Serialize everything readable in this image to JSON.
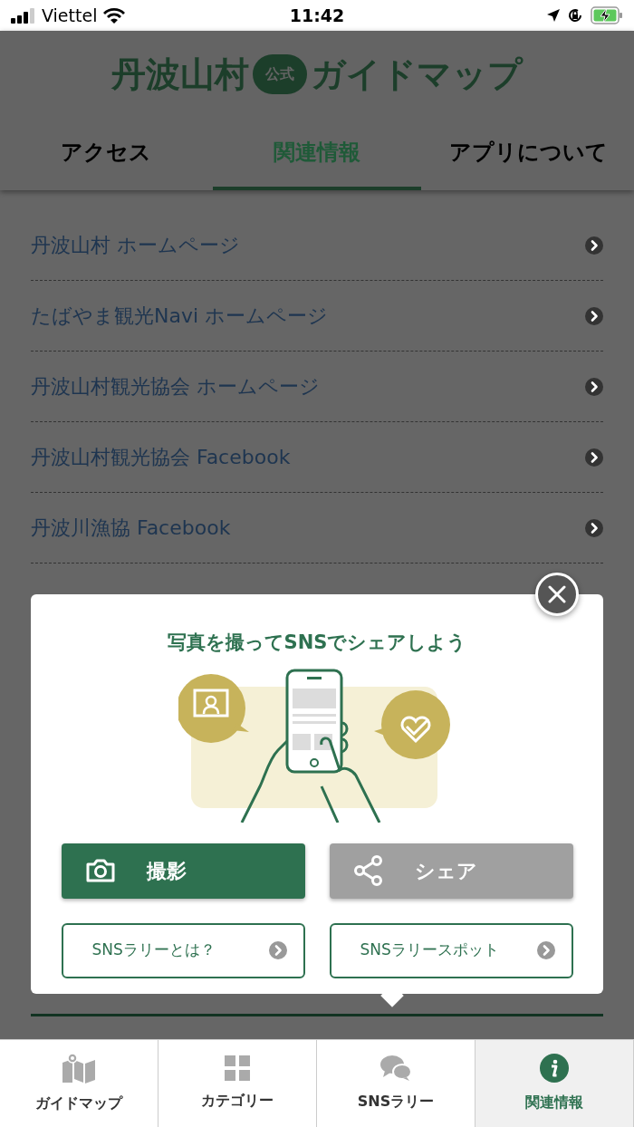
{
  "status_bar": {
    "carrier": "Viettel",
    "time": "11:42"
  },
  "logo": {
    "name": "丹波山村",
    "badge": "公式",
    "title": "ガイドマップ"
  },
  "tabs": [
    {
      "label": "アクセス",
      "selected": false
    },
    {
      "label": "関連情報",
      "selected": true
    },
    {
      "label": "アプリについて",
      "selected": false
    }
  ],
  "links": [
    {
      "label": "丹波山村 ホームページ"
    },
    {
      "label": "たばやま観光Navi ホームページ"
    },
    {
      "label": "丹波山村観光協会 ホームページ"
    },
    {
      "label": "丹波山村観光協会 Facebook"
    },
    {
      "label": "丹波川漁協 Facebook"
    }
  ],
  "popup": {
    "title": "写真を撮ってSNSでシェアしよう",
    "actions": [
      {
        "label": "撮影",
        "kind": "camera",
        "disabled": false
      },
      {
        "label": "シェア",
        "kind": "share",
        "disabled": true
      }
    ],
    "link_buttons": [
      {
        "label": "SNSラリーとは？"
      },
      {
        "label": "SNSラリースポット"
      }
    ]
  },
  "bottom_nav": [
    {
      "label": "ガイドマップ",
      "kind": "map",
      "selected": false
    },
    {
      "label": "カテゴリー",
      "kind": "grid",
      "selected": false
    },
    {
      "label": "SNSラリー",
      "kind": "chat",
      "selected": false
    },
    {
      "label": "関連情報",
      "kind": "info",
      "selected": true
    }
  ]
}
